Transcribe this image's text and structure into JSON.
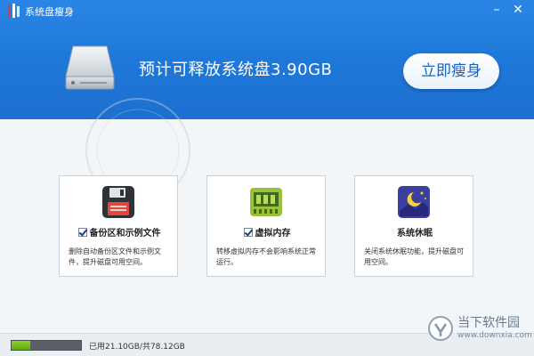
{
  "window": {
    "title": "系统盘瘦身",
    "minimize_glyph": "–",
    "close_glyph": "✕"
  },
  "header": {
    "headline": "预计可释放系统盘3.90GB",
    "slim_button": "立即瘦身",
    "drive_icon": "hard-drive-icon"
  },
  "options": [
    {
      "icon": "floppy-disk-icon",
      "checked": true,
      "title": "备份区和示例文件",
      "description": "删除自动备份区文件和示例文件，提升磁盘可用空间。"
    },
    {
      "icon": "memory-chip-icon",
      "checked": true,
      "title": "虚拟内存",
      "description": "转移虚拟内存不会影响系统正常运行。"
    },
    {
      "icon": "moon-stars-icon",
      "checked": false,
      "title": "系统休眠",
      "description": "关闭系统休眠功能，提升磁盘可用空间。"
    }
  ],
  "disk": {
    "usage_text": "已用21.10GB/共78.12GB",
    "used_fraction": 0.27
  },
  "watermark": {
    "name": "当下软件园",
    "url": "www.downxia.com"
  },
  "colors": {
    "header_blue": "#2a86e6",
    "button_text": "#1a64bf",
    "progress_green": "#74c01c"
  }
}
